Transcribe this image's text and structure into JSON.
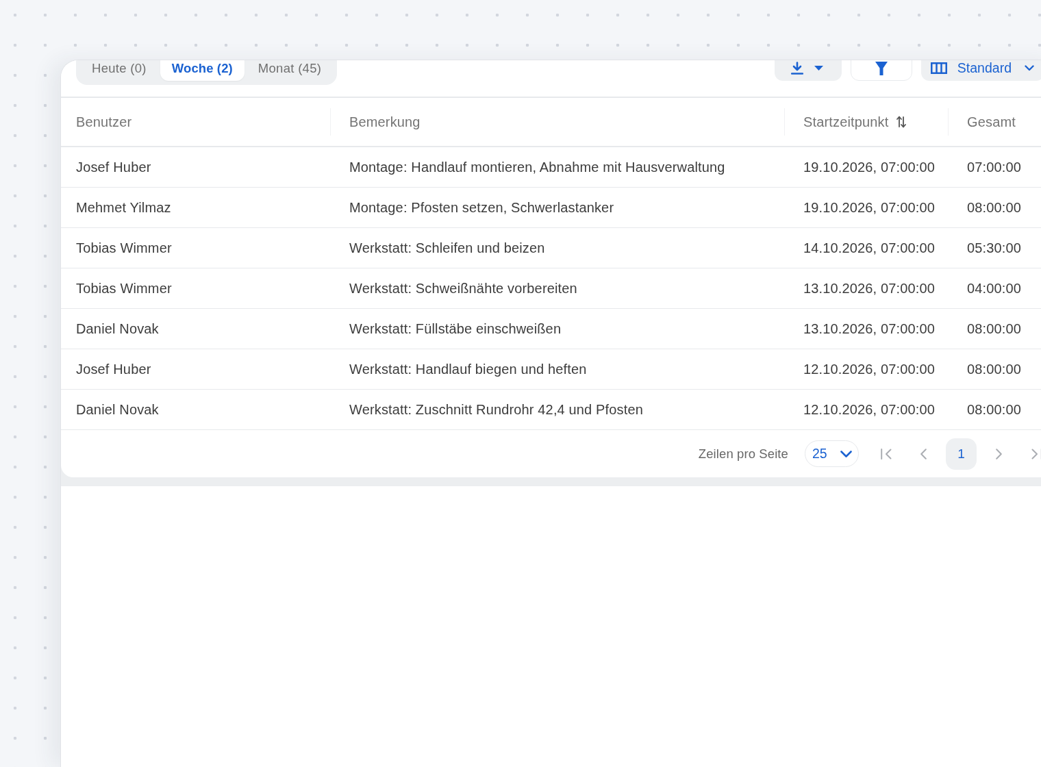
{
  "view_tabs": [
    {
      "label": "Heute (0)",
      "selected": false
    },
    {
      "label": "Woche (2)",
      "selected": true
    },
    {
      "label": "Monat (45)",
      "selected": false
    }
  ],
  "toolbar": {
    "actions": [
      {
        "kind": "export"
      },
      {
        "kind": "filter"
      },
      {
        "kind": "view",
        "label": "Standard"
      }
    ]
  },
  "table": {
    "columns": [
      {
        "label": "Benutzer",
        "sortable": false
      },
      {
        "label": "Bemerkung",
        "sortable": false
      },
      {
        "label": "Startzeitpunkt",
        "sortable": true
      },
      {
        "label": "Gesamt",
        "sortable": false
      }
    ],
    "rows": [
      {
        "cells": [
          "Josef Huber",
          "Montage: Handlauf montieren, Abnahme mit Hausverwaltung",
          "19.10.2026, 07:00:00",
          "07:00:00"
        ]
      },
      {
        "cells": [
          "Mehmet Yilmaz",
          "Montage: Pfosten setzen, Schwerlastanker",
          "19.10.2026, 07:00:00",
          "08:00:00"
        ]
      },
      {
        "cells": [
          "Tobias Wimmer",
          "Werkstatt: Schleifen und beizen",
          "14.10.2026, 07:00:00",
          "05:30:00"
        ]
      },
      {
        "cells": [
          "Tobias Wimmer",
          "Werkstatt: Schweißnähte vorbereiten",
          "13.10.2026, 07:00:00",
          "04:00:00"
        ]
      },
      {
        "cells": [
          "Daniel Novak",
          "Werkstatt: Füllstäbe einschweißen",
          "13.10.2026, 07:00:00",
          "08:00:00"
        ]
      },
      {
        "cells": [
          "Josef Huber",
          "Werkstatt: Handlauf biegen und heften",
          "12.10.2026, 07:00:00",
          "08:00:00"
        ]
      },
      {
        "cells": [
          "Daniel Novak",
          "Werkstatt: Zuschnitt Rundrohr 42,4 und Pfosten",
          "12.10.2026, 07:00:00",
          "08:00:00"
        ]
      }
    ]
  },
  "pagination": {
    "rows_per_page_label": "Zeilen pro Seite",
    "rows_per_page": "25",
    "nav_before": [
      {
        "kind": "first",
        "disabled": true
      },
      {
        "kind": "previous",
        "disabled": true
      }
    ],
    "pages": [
      {
        "label": "1",
        "selected": true
      }
    ],
    "nav_after": [
      {
        "kind": "next",
        "disabled": true
      },
      {
        "kind": "last",
        "disabled": true
      }
    ]
  }
}
